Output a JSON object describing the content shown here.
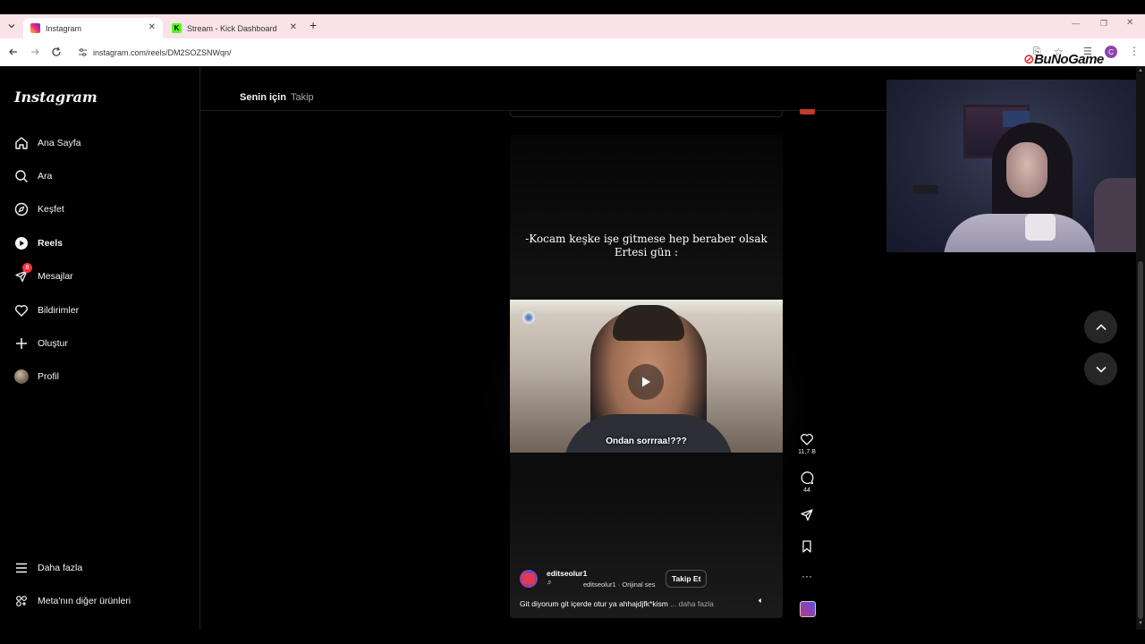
{
  "browser": {
    "tabs": [
      {
        "title": "Instagram",
        "active": true
      },
      {
        "title": "Stream - Kick Dashboard",
        "active": false
      }
    ],
    "new_tab": "+",
    "url": "instagram.com/reels/DM2SOZSNWqn/",
    "window_controls": [
      "minimize",
      "restore",
      "close"
    ]
  },
  "watermark": "BuNoGame",
  "sidebar": {
    "logo": "Instagram",
    "items": [
      {
        "label": "Ana Sayfa",
        "icon": "home-icon"
      },
      {
        "label": "Ara",
        "icon": "search-icon"
      },
      {
        "label": "Keşfet",
        "icon": "compass-icon"
      },
      {
        "label": "Reels",
        "icon": "reels-icon",
        "active": true
      },
      {
        "label": "Mesajlar",
        "icon": "messenger-icon",
        "badge": "8"
      },
      {
        "label": "Bildirimler",
        "icon": "heart-icon"
      },
      {
        "label": "Oluştur",
        "icon": "plus-icon"
      },
      {
        "label": "Profil",
        "icon": "avatar"
      }
    ],
    "bottom_items": [
      {
        "label": "Daha fazla",
        "icon": "menu-icon"
      },
      {
        "label": "Meta'nın diğer ürünleri",
        "icon": "meta-icon"
      }
    ]
  },
  "feed_tabs": [
    {
      "label": "Senin için",
      "active": true
    },
    {
      "label": "Takip",
      "active": false
    }
  ],
  "reel": {
    "overlay_text_line1": "-Kocam keşke işe gitmese hep beraber olsak",
    "overlay_text_line2": "Ertesi gün :",
    "subtitle": "Ondan sorrraa!???",
    "username": "editseolur1",
    "audio": "editseolur1 · Orijinal ses",
    "follow_label": "Takip Et",
    "caption": "Git diyorum git içerde otur ya ahhajdjfk*kism",
    "more_label": "... daha fazla"
  },
  "actions": {
    "likes": "11,7 B",
    "comments": "44"
  },
  "colors": {
    "tabstrip": "#f9e3e8",
    "badge": "#ff3040",
    "background": "#000000"
  }
}
